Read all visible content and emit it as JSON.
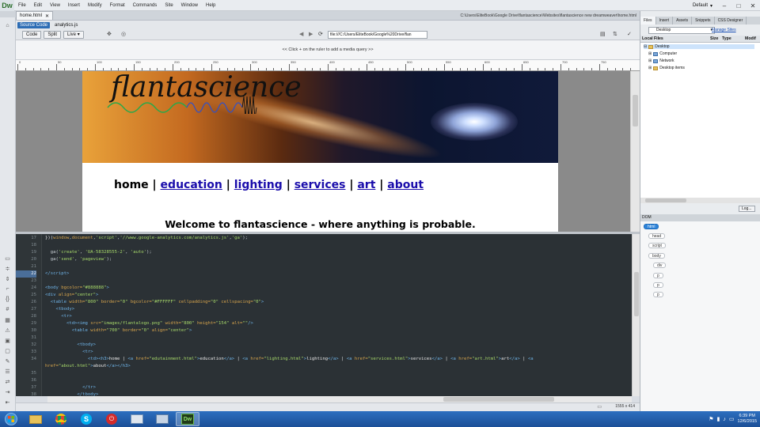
{
  "app": {
    "logo": "Dw",
    "menu": [
      "File",
      "Edit",
      "View",
      "Insert",
      "Modify",
      "Format",
      "Commands",
      "Site",
      "Window",
      "Help"
    ],
    "workspace": "Default"
  },
  "document": {
    "tab_name": "home.html",
    "path": "C:\\Users\\EliteBook\\Google Drive\\flantascience\\Websites\\flantascience new dreamweaver\\home.html",
    "source_code_label": "Source Code",
    "related_file": "analytics.js"
  },
  "toolbar": {
    "code": "Code",
    "split": "Split",
    "live": "Live",
    "address": "file:///C:/Users/EliteBook/Google%20Drive/flan"
  },
  "media_query_hint": "<< Click + on the ruler to add a media query >>",
  "ruler": {
    "ticks": [
      "0",
      "50",
      "100",
      "150",
      "200",
      "250",
      "300",
      "350",
      "400",
      "450",
      "500",
      "550",
      "600",
      "650",
      "700",
      "750"
    ]
  },
  "page_preview": {
    "logo": "flantascience",
    "nav": [
      "home",
      "education",
      "lighting",
      "services",
      "art",
      "about"
    ],
    "nav_separator": "|",
    "welcome": "Welcome to flantascience - where anything is probable."
  },
  "code": {
    "active_line": "22",
    "lines": [
      {
        "n": "17",
        "html": "<span class='txt'>})(</span><span class='att'>window</span>,<span class='att'>document</span>,<span class='str'>'script'</span>,<span class='str'>'//www.google-analytics.com/analytics.js'</span>,<span class='str'>'ga'</span>);"
      },
      {
        "n": "18",
        "html": ""
      },
      {
        "n": "19",
        "html": "  ga(<span class='str'>'create'</span>, <span class='str'>'UA-58328555-2'</span>, <span class='str'>'auto'</span>);"
      },
      {
        "n": "20",
        "html": "  ga(<span class='str'>'send'</span>, <span class='str'>'pageview'</span>);"
      },
      {
        "n": "21",
        "html": ""
      },
      {
        "n": "22",
        "html": "<span class='tag'>&lt;/script&gt;</span>"
      },
      {
        "n": "23",
        "html": ""
      },
      {
        "n": "24",
        "html": "<span class='tag'>&lt;body</span> <span class='att'>bgcolor=</span><span class='str'>\"#888888\"</span><span class='tag'>&gt;</span>"
      },
      {
        "n": "25",
        "html": "<span class='tag'>&lt;div</span> <span class='att'>align=</span><span class='str'>\"center\"</span><span class='tag'>&gt;</span>"
      },
      {
        "n": "26",
        "html": "  <span class='tag'>&lt;table</span> <span class='att'>width=</span><span class='str'>\"800\"</span> <span class='att'>border=</span><span class='str'>\"0\"</span> <span class='att'>bgcolor=</span><span class='str'>\"#FFFFFF\"</span> <span class='att'>cellpadding=</span><span class='str'>\"0\"</span> <span class='att'>cellspacing=</span><span class='str'>\"0\"</span><span class='tag'>&gt;</span>"
      },
      {
        "n": "27",
        "html": "    <span class='tag'>&lt;tbody&gt;</span>"
      },
      {
        "n": "28",
        "html": "      <span class='tag'>&lt;tr&gt;</span>"
      },
      {
        "n": "29",
        "html": "        <span class='tag'>&lt;td&gt;&lt;img</span> <span class='att'>src=</span><span class='str'>\"images/flantalogo.png\"</span> <span class='att'>width=</span><span class='str'>\"800\"</span> <span class='att'>height=</span><span class='str'>\"154\"</span> <span class='att'>alt=</span><span class='str'>\"\"</span><span class='tag'>/&gt;</span>"
      },
      {
        "n": "30",
        "html": "          <span class='tag'>&lt;table</span> <span class='att'>width=</span><span class='str'>\"700\"</span> <span class='att'>border=</span><span class='str'>\"0\"</span> <span class='att'>align=</span><span class='str'>\"center\"</span><span class='tag'>&gt;</span>"
      },
      {
        "n": "31",
        "html": ""
      },
      {
        "n": "32",
        "html": "            <span class='tag'>&lt;tbody&gt;</span>"
      },
      {
        "n": "33",
        "html": "              <span class='tag'>&lt;tr&gt;</span>"
      },
      {
        "n": "34",
        "html": "                <span class='tag'>&lt;td&gt;&lt;h3&gt;</span><span class='txt'>home | </span><span class='tag'>&lt;a</span> <span class='att'>href=</span><span class='str'>\"edutainment.html\"</span><span class='tag'>&gt;</span><span class='txt'>education</span><span class='tag'>&lt;/a&gt;</span><span class='txt'> | </span><span class='tag'>&lt;a</span> <span class='att'>href=</span><span class='str'>\"lighting.html\"</span><span class='tag'>&gt;</span><span class='txt'>lighting</span><span class='tag'>&lt;/a&gt;</span><span class='txt'> | </span><span class='tag'>&lt;a</span> <span class='att'>href=</span><span class='str'>\"services.html\"</span><span class='tag'>&gt;</span><span class='txt'>services</span><span class='tag'>&lt;/a&gt;</span><span class='txt'> | </span><span class='tag'>&lt;a</span> <span class='att'>href=</span><span class='str'>\"art.html\"</span><span class='tag'>&gt;</span><span class='txt'>art</span><span class='tag'>&lt;/a&gt;</span><span class='txt'> | </span><span class='tag'>&lt;a</span>"
      },
      {
        "n": "",
        "html": "<span class='att'>href=</span><span class='str'>\"about.html\"</span><span class='tag'>&gt;</span><span class='txt'>about</span><span class='tag'>&lt;/a&gt;&lt;/h3&gt;</span>"
      },
      {
        "n": "35",
        "html": ""
      },
      {
        "n": "36",
        "html": ""
      },
      {
        "n": "37",
        "html": "              <span class='tag'>&lt;/tr&gt;</span>"
      },
      {
        "n": "38",
        "html": "            <span class='tag'>&lt;/tbody&gt;</span>"
      }
    ]
  },
  "status": {
    "size": "1555 x 414"
  },
  "files_panel": {
    "tabs": [
      "Files",
      "Insert",
      "Assets",
      "Snippets",
      "CSS Designer"
    ],
    "site": "Desktop",
    "manage_sites": "Manage Sites",
    "columns": [
      "Local Files",
      "Size",
      "Type",
      "Modif"
    ],
    "items": [
      "Desktop",
      "Computer",
      "Network",
      "Desktop items"
    ],
    "log": "Log..."
  },
  "dom_panel": {
    "title": "DOM",
    "nodes": [
      "html",
      "head",
      "script",
      "body",
      "div",
      "p",
      "p",
      "p"
    ]
  },
  "taskbar": {
    "time": "6:39 PM",
    "date": "12/6/2015"
  }
}
